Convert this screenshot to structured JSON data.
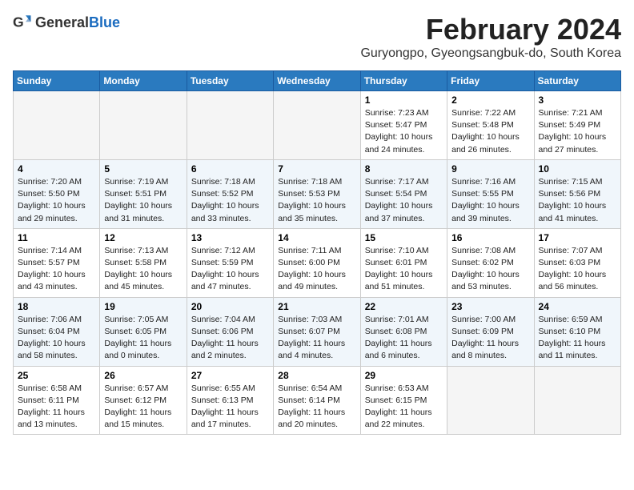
{
  "header": {
    "logo_general": "General",
    "logo_blue": "Blue",
    "month_title": "February 2024",
    "subtitle": "Guryongpo, Gyeongsangbuk-do, South Korea"
  },
  "columns": [
    "Sunday",
    "Monday",
    "Tuesday",
    "Wednesday",
    "Thursday",
    "Friday",
    "Saturday"
  ],
  "weeks": [
    {
      "shade": false,
      "days": [
        {
          "num": "",
          "info": ""
        },
        {
          "num": "",
          "info": ""
        },
        {
          "num": "",
          "info": ""
        },
        {
          "num": "",
          "info": ""
        },
        {
          "num": "1",
          "info": "Sunrise: 7:23 AM\nSunset: 5:47 PM\nDaylight: 10 hours\nand 24 minutes."
        },
        {
          "num": "2",
          "info": "Sunrise: 7:22 AM\nSunset: 5:48 PM\nDaylight: 10 hours\nand 26 minutes."
        },
        {
          "num": "3",
          "info": "Sunrise: 7:21 AM\nSunset: 5:49 PM\nDaylight: 10 hours\nand 27 minutes."
        }
      ]
    },
    {
      "shade": true,
      "days": [
        {
          "num": "4",
          "info": "Sunrise: 7:20 AM\nSunset: 5:50 PM\nDaylight: 10 hours\nand 29 minutes."
        },
        {
          "num": "5",
          "info": "Sunrise: 7:19 AM\nSunset: 5:51 PM\nDaylight: 10 hours\nand 31 minutes."
        },
        {
          "num": "6",
          "info": "Sunrise: 7:18 AM\nSunset: 5:52 PM\nDaylight: 10 hours\nand 33 minutes."
        },
        {
          "num": "7",
          "info": "Sunrise: 7:18 AM\nSunset: 5:53 PM\nDaylight: 10 hours\nand 35 minutes."
        },
        {
          "num": "8",
          "info": "Sunrise: 7:17 AM\nSunset: 5:54 PM\nDaylight: 10 hours\nand 37 minutes."
        },
        {
          "num": "9",
          "info": "Sunrise: 7:16 AM\nSunset: 5:55 PM\nDaylight: 10 hours\nand 39 minutes."
        },
        {
          "num": "10",
          "info": "Sunrise: 7:15 AM\nSunset: 5:56 PM\nDaylight: 10 hours\nand 41 minutes."
        }
      ]
    },
    {
      "shade": false,
      "days": [
        {
          "num": "11",
          "info": "Sunrise: 7:14 AM\nSunset: 5:57 PM\nDaylight: 10 hours\nand 43 minutes."
        },
        {
          "num": "12",
          "info": "Sunrise: 7:13 AM\nSunset: 5:58 PM\nDaylight: 10 hours\nand 45 minutes."
        },
        {
          "num": "13",
          "info": "Sunrise: 7:12 AM\nSunset: 5:59 PM\nDaylight: 10 hours\nand 47 minutes."
        },
        {
          "num": "14",
          "info": "Sunrise: 7:11 AM\nSunset: 6:00 PM\nDaylight: 10 hours\nand 49 minutes."
        },
        {
          "num": "15",
          "info": "Sunrise: 7:10 AM\nSunset: 6:01 PM\nDaylight: 10 hours\nand 51 minutes."
        },
        {
          "num": "16",
          "info": "Sunrise: 7:08 AM\nSunset: 6:02 PM\nDaylight: 10 hours\nand 53 minutes."
        },
        {
          "num": "17",
          "info": "Sunrise: 7:07 AM\nSunset: 6:03 PM\nDaylight: 10 hours\nand 56 minutes."
        }
      ]
    },
    {
      "shade": true,
      "days": [
        {
          "num": "18",
          "info": "Sunrise: 7:06 AM\nSunset: 6:04 PM\nDaylight: 10 hours\nand 58 minutes."
        },
        {
          "num": "19",
          "info": "Sunrise: 7:05 AM\nSunset: 6:05 PM\nDaylight: 11 hours\nand 0 minutes."
        },
        {
          "num": "20",
          "info": "Sunrise: 7:04 AM\nSunset: 6:06 PM\nDaylight: 11 hours\nand 2 minutes."
        },
        {
          "num": "21",
          "info": "Sunrise: 7:03 AM\nSunset: 6:07 PM\nDaylight: 11 hours\nand 4 minutes."
        },
        {
          "num": "22",
          "info": "Sunrise: 7:01 AM\nSunset: 6:08 PM\nDaylight: 11 hours\nand 6 minutes."
        },
        {
          "num": "23",
          "info": "Sunrise: 7:00 AM\nSunset: 6:09 PM\nDaylight: 11 hours\nand 8 minutes."
        },
        {
          "num": "24",
          "info": "Sunrise: 6:59 AM\nSunset: 6:10 PM\nDaylight: 11 hours\nand 11 minutes."
        }
      ]
    },
    {
      "shade": false,
      "days": [
        {
          "num": "25",
          "info": "Sunrise: 6:58 AM\nSunset: 6:11 PM\nDaylight: 11 hours\nand 13 minutes."
        },
        {
          "num": "26",
          "info": "Sunrise: 6:57 AM\nSunset: 6:12 PM\nDaylight: 11 hours\nand 15 minutes."
        },
        {
          "num": "27",
          "info": "Sunrise: 6:55 AM\nSunset: 6:13 PM\nDaylight: 11 hours\nand 17 minutes."
        },
        {
          "num": "28",
          "info": "Sunrise: 6:54 AM\nSunset: 6:14 PM\nDaylight: 11 hours\nand 20 minutes."
        },
        {
          "num": "29",
          "info": "Sunrise: 6:53 AM\nSunset: 6:15 PM\nDaylight: 11 hours\nand 22 minutes."
        },
        {
          "num": "",
          "info": ""
        },
        {
          "num": "",
          "info": ""
        }
      ]
    }
  ]
}
